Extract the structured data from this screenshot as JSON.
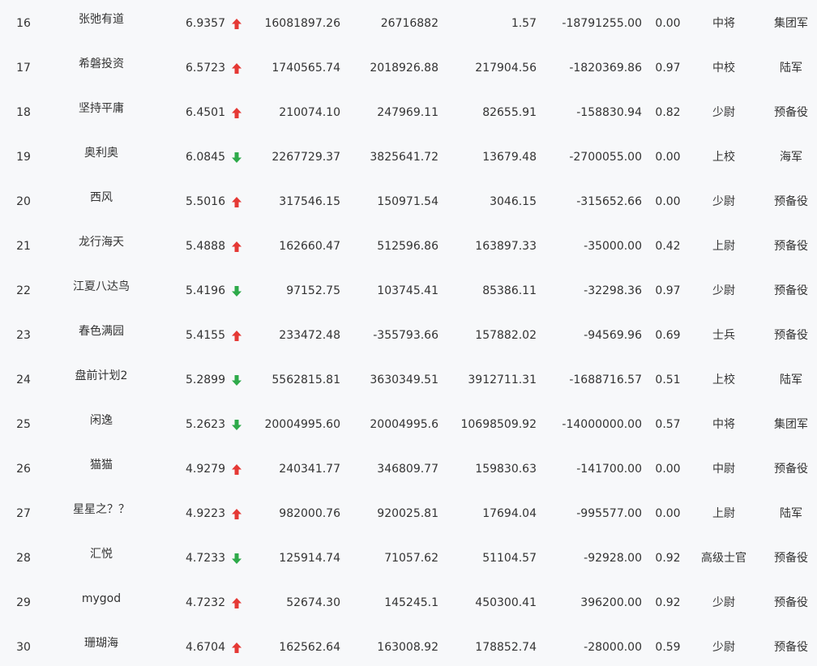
{
  "colors": {
    "up": "#e53935",
    "down": "#2eaa4a",
    "text": "#333333",
    "background": "#f7f8fa"
  },
  "rows": [
    {
      "rank": "16",
      "name": "张弛有道",
      "score": "6.9357",
      "trend": "up",
      "c1": "16081897.26",
      "c2": "26716882",
      "c3": "1.57",
      "c4": "-18791255.00",
      "ratio": "0.00",
      "title": "中将",
      "unit": "集团军"
    },
    {
      "rank": "17",
      "name": "希磐投资",
      "score": "6.5723",
      "trend": "up",
      "c1": "1740565.74",
      "c2": "2018926.88",
      "c3": "217904.56",
      "c4": "-1820369.86",
      "ratio": "0.97",
      "title": "中校",
      "unit": "陆军"
    },
    {
      "rank": "18",
      "name": "坚持平庸",
      "score": "6.4501",
      "trend": "up",
      "c1": "210074.10",
      "c2": "247969.11",
      "c3": "82655.91",
      "c4": "-158830.94",
      "ratio": "0.82",
      "title": "少尉",
      "unit": "预备役"
    },
    {
      "rank": "19",
      "name": "奥利奥",
      "score": "6.0845",
      "trend": "down",
      "c1": "2267729.37",
      "c2": "3825641.72",
      "c3": "13679.48",
      "c4": "-2700055.00",
      "ratio": "0.00",
      "title": "上校",
      "unit": "海军"
    },
    {
      "rank": "20",
      "name": "西风",
      "score": "5.5016",
      "trend": "up",
      "c1": "317546.15",
      "c2": "150971.54",
      "c3": "3046.15",
      "c4": "-315652.66",
      "ratio": "0.00",
      "title": "少尉",
      "unit": "预备役"
    },
    {
      "rank": "21",
      "name": "龙行海天",
      "score": "5.4888",
      "trend": "up",
      "c1": "162660.47",
      "c2": "512596.86",
      "c3": "163897.33",
      "c4": "-35000.00",
      "ratio": "0.42",
      "title": "上尉",
      "unit": "预备役"
    },
    {
      "rank": "22",
      "name": "江夏八达鸟",
      "score": "5.4196",
      "trend": "down",
      "c1": "97152.75",
      "c2": "103745.41",
      "c3": "85386.11",
      "c4": "-32298.36",
      "ratio": "0.97",
      "title": "少尉",
      "unit": "预备役"
    },
    {
      "rank": "23",
      "name": "春色满园",
      "score": "5.4155",
      "trend": "up",
      "c1": "233472.48",
      "c2": "-355793.66",
      "c3": "157882.02",
      "c4": "-94569.96",
      "ratio": "0.69",
      "title": "士兵",
      "unit": "预备役"
    },
    {
      "rank": "24",
      "name": "盘前计划2",
      "score": "5.2899",
      "trend": "down",
      "c1": "5562815.81",
      "c2": "3630349.51",
      "c3": "3912711.31",
      "c4": "-1688716.57",
      "ratio": "0.51",
      "title": "上校",
      "unit": "陆军"
    },
    {
      "rank": "25",
      "name": "闲逸",
      "score": "5.2623",
      "trend": "down",
      "c1": "20004995.60",
      "c2": "20004995.6",
      "c3": "10698509.92",
      "c4": "-14000000.00",
      "ratio": "0.57",
      "title": "中将",
      "unit": "集团军"
    },
    {
      "rank": "26",
      "name": "猫猫",
      "score": "4.9279",
      "trend": "up",
      "c1": "240341.77",
      "c2": "346809.77",
      "c3": "159830.63",
      "c4": "-141700.00",
      "ratio": "0.00",
      "title": "中尉",
      "unit": "预备役"
    },
    {
      "rank": "27",
      "name": "星星之？？",
      "score": "4.9223",
      "trend": "up",
      "c1": "982000.76",
      "c2": "920025.81",
      "c3": "17694.04",
      "c4": "-995577.00",
      "ratio": "0.00",
      "title": "上尉",
      "unit": "陆军"
    },
    {
      "rank": "28",
      "name": "汇悦",
      "score": "4.7233",
      "trend": "down",
      "c1": "125914.74",
      "c2": "71057.62",
      "c3": "51104.57",
      "c4": "-92928.00",
      "ratio": "0.92",
      "title": "高级士官",
      "unit": "预备役"
    },
    {
      "rank": "29",
      "name": "mygod",
      "score": "4.7232",
      "trend": "up",
      "c1": "52674.30",
      "c2": "145245.1",
      "c3": "450300.41",
      "c4": "396200.00",
      "ratio": "0.92",
      "title": "少尉",
      "unit": "预备役"
    },
    {
      "rank": "30",
      "name": "珊瑚海",
      "score": "4.6704",
      "trend": "up",
      "c1": "162562.64",
      "c2": "163008.92",
      "c3": "178852.74",
      "c4": "-28000.00",
      "ratio": "0.59",
      "title": "少尉",
      "unit": "预备役"
    }
  ]
}
